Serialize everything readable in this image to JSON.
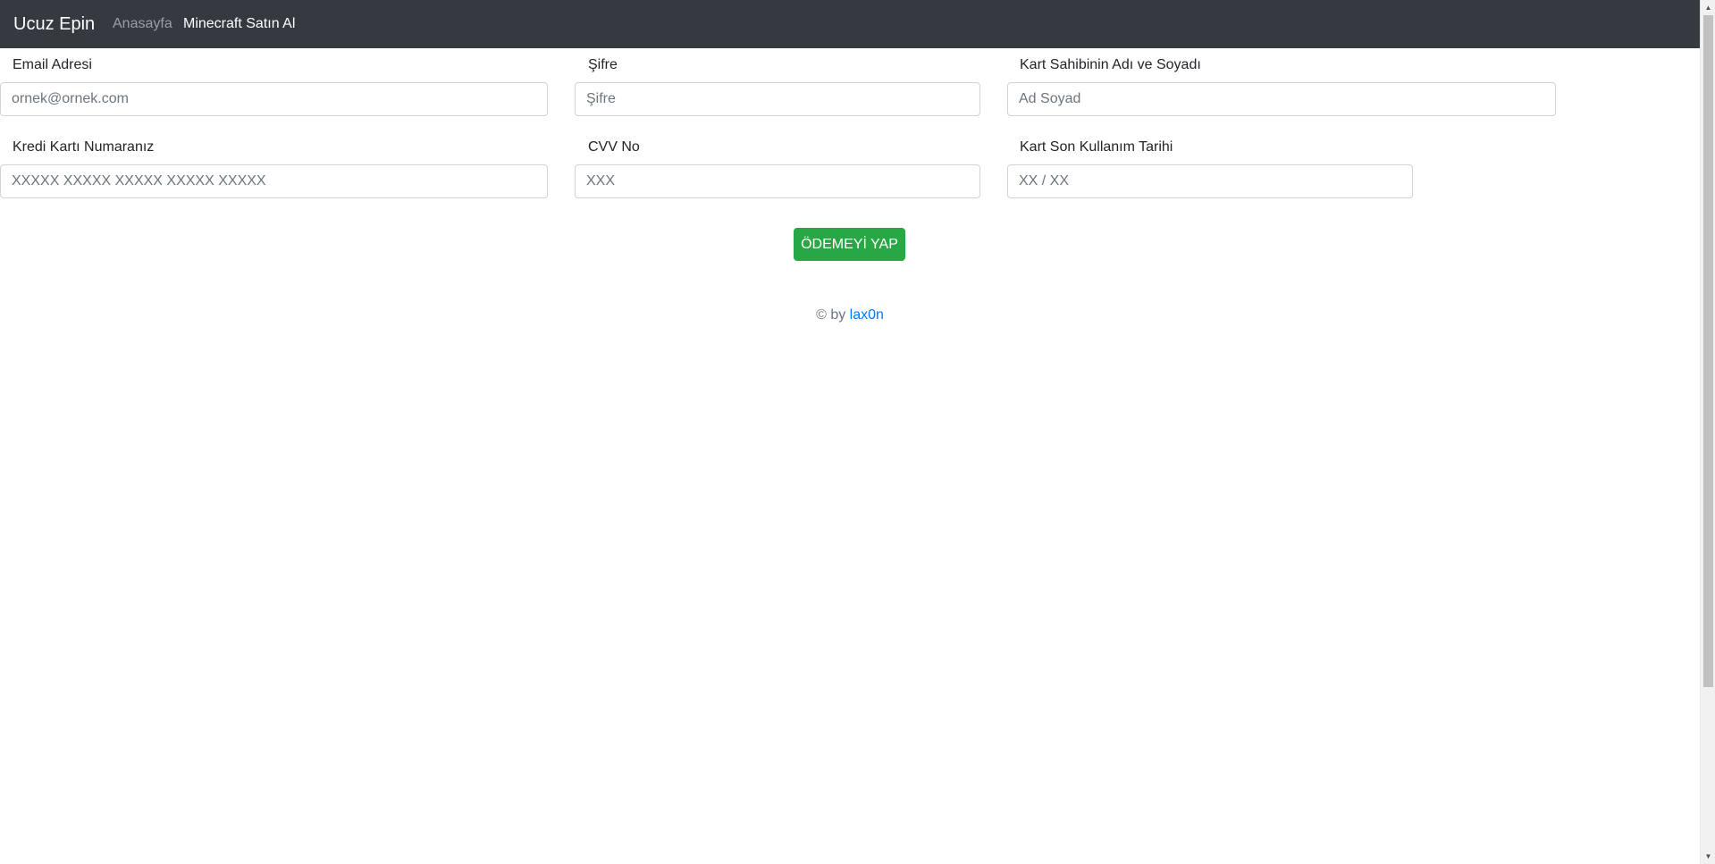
{
  "navbar": {
    "brand": "Ucuz Epin",
    "links": [
      "Anasayfa",
      "Minecraft Satın Al"
    ]
  },
  "form": {
    "email": {
      "label": "Email Adresi",
      "placeholder": "ornek@ornek.com"
    },
    "password": {
      "label": "Şifre",
      "placeholder": "Şifre"
    },
    "card_holder": {
      "label": "Kart Sahibinin Adı ve Soyadı",
      "placeholder": "Ad Soyad"
    },
    "card_number": {
      "label": "Kredi Kartı Numaranız",
      "placeholder": "XXXXX XXXXX XXXXX XXXXX XXXXX"
    },
    "cvv": {
      "label": "CVV No",
      "placeholder": "XXX"
    },
    "expiry": {
      "label": "Kart Son Kullanım Tarihi",
      "placeholder": "XX / XX"
    },
    "submit_label": "ÖDEMEYİ YAP"
  },
  "footer": {
    "prefix": "© by",
    "author": "lax0n"
  },
  "colors": {
    "navbar_bg": "#343a40",
    "button_bg": "#28a745",
    "link": "#007bff"
  }
}
